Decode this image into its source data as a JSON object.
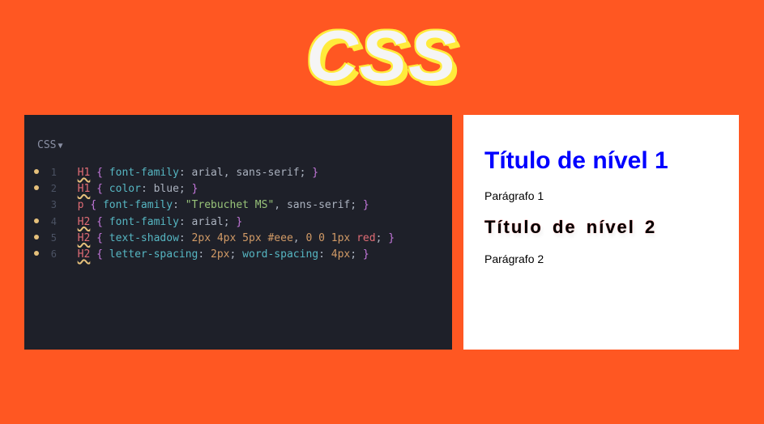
{
  "header": {
    "title": "CSS"
  },
  "editor": {
    "lang_label": "CSS",
    "lines": [
      {
        "n": "1",
        "dot": true,
        "sel": "H1",
        "ul": true,
        "rules": [
          {
            "prop": "font-family",
            "vals": [
              {
                "t": "plain",
                "v": "arial"
              },
              {
                "t": "comma",
                "v": ", "
              },
              {
                "t": "plain",
                "v": "sans-serif"
              }
            ]
          }
        ]
      },
      {
        "n": "2",
        "dot": true,
        "sel": "H1",
        "ul": true,
        "rules": [
          {
            "prop": "color",
            "vals": [
              {
                "t": "plain",
                "v": "blue"
              }
            ]
          }
        ]
      },
      {
        "n": "3",
        "dot": false,
        "sel": "p",
        "ul": false,
        "rules": [
          {
            "prop": "font-family",
            "vals": [
              {
                "t": "str",
                "v": "\"Trebuchet MS\""
              },
              {
                "t": "comma",
                "v": ", "
              },
              {
                "t": "plain",
                "v": "sans-serif"
              }
            ]
          }
        ]
      },
      {
        "n": "4",
        "dot": true,
        "sel": "H2",
        "ul": true,
        "rules": [
          {
            "prop": "font-family",
            "vals": [
              {
                "t": "plain",
                "v": "arial"
              }
            ]
          }
        ]
      },
      {
        "n": "5",
        "dot": true,
        "sel": "H2",
        "ul": true,
        "rules": [
          {
            "prop": "text-shadow",
            "vals": [
              {
                "t": "num",
                "v": "2px"
              },
              {
                "t": "sp",
                "v": " "
              },
              {
                "t": "num",
                "v": "4px"
              },
              {
                "t": "sp",
                "v": " "
              },
              {
                "t": "num",
                "v": "5px"
              },
              {
                "t": "sp",
                "v": " "
              },
              {
                "t": "num",
                "v": "#eee"
              },
              {
                "t": "comma",
                "v": ", "
              },
              {
                "t": "num",
                "v": "0"
              },
              {
                "t": "sp",
                "v": " "
              },
              {
                "t": "num",
                "v": "0"
              },
              {
                "t": "sp",
                "v": " "
              },
              {
                "t": "num",
                "v": "1px"
              },
              {
                "t": "sp",
                "v": " "
              },
              {
                "t": "kw",
                "v": "red"
              }
            ]
          }
        ]
      },
      {
        "n": "6",
        "dot": true,
        "sel": "H2",
        "ul": true,
        "rules": [
          {
            "prop": "letter-spacing",
            "vals": [
              {
                "t": "num",
                "v": "2px"
              }
            ]
          },
          {
            "prop": "word-spacing",
            "vals": [
              {
                "t": "num",
                "v": "4px"
              }
            ]
          }
        ]
      }
    ]
  },
  "preview": {
    "h1": "Título de nível 1",
    "p1": "Parágrafo 1",
    "h2": "Título de nível 2",
    "p2": "Parágrafo 2"
  }
}
